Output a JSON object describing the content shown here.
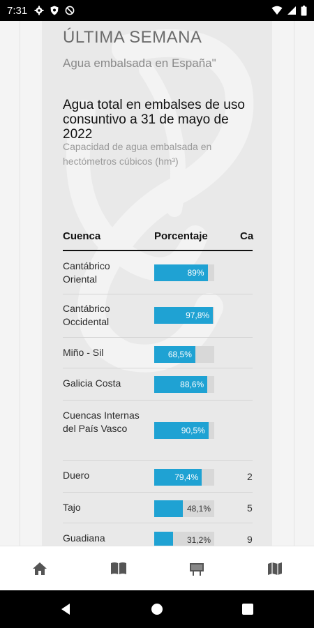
{
  "status_bar": {
    "time": "7:31",
    "left_icons": [
      "gear-icon",
      "shield-icon",
      "no-data-icon"
    ],
    "right_icons": [
      "wifi-icon",
      "signal-icon",
      "battery-icon"
    ]
  },
  "card": {
    "title": "ÚLTIMA SEMANA",
    "subtitle": "Agua embalsada en España\"",
    "heading": "Agua total en embalses de uso consuntivo a 31 de mayo de 2022",
    "caption": "Capacidad de agua embalsada en hectómetros cúbicos (hm³)"
  },
  "table": {
    "headers": {
      "cuenca": "Cuenca",
      "porcentaje": "Porcentaje",
      "capacidad": "Ca"
    },
    "rows": [
      {
        "name": "Cantábrico Oriental",
        "pct_label": "89%",
        "pct": 89,
        "cap": ""
      },
      {
        "name": "Cantábrico Occidental",
        "pct_label": "97,8%",
        "pct": 97.8,
        "cap": ""
      },
      {
        "name": "Miño - Sil",
        "pct_label": "68,5%",
        "pct": 68.5,
        "cap": ""
      },
      {
        "name": "Galicia Costa",
        "pct_label": "88,6%",
        "pct": 88.6,
        "cap": ""
      },
      {
        "name": "Cuencas Internas del País Vasco",
        "pct_label": "90,5%",
        "pct": 90.5,
        "cap": ""
      },
      {
        "name": "Duero",
        "pct_label": "79,4%",
        "pct": 79.4,
        "cap": "2"
      },
      {
        "name": "Tajo",
        "pct_label": "48,1%",
        "pct": 48.1,
        "cap": "5"
      },
      {
        "name": "Guadiana",
        "pct_label": "31,2%",
        "pct": 31.2,
        "cap": "9"
      }
    ]
  },
  "bottom_nav": {
    "items": [
      "home-icon",
      "book-icon",
      "billboard-icon",
      "map-icon"
    ]
  },
  "colors": {
    "bar_fill": "#1fa2d3",
    "bar_track": "#d8d8d8",
    "card_bg": "#e9e9e9"
  }
}
